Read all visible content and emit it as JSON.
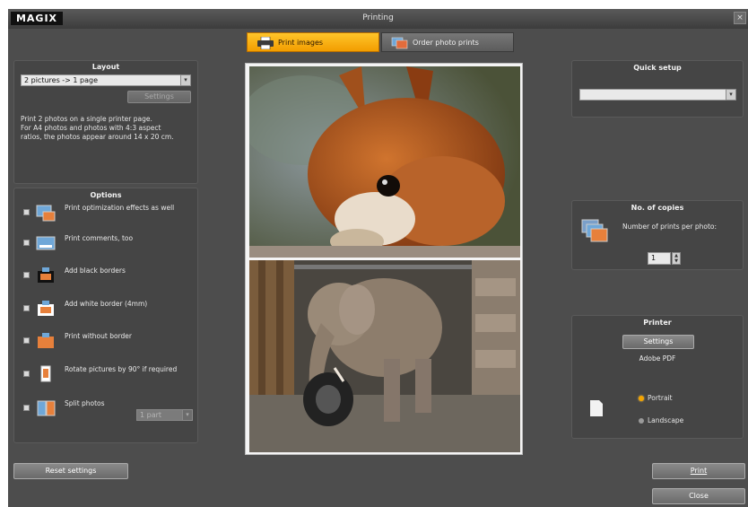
{
  "window": {
    "logo": "MAGIX",
    "title": "Printing",
    "close_glyph": "×"
  },
  "tabs": [
    {
      "label": "Print images",
      "icon": "printer-icon",
      "active": true
    },
    {
      "label": "Order photo prints",
      "icon": "photo-order-icon",
      "active": false
    }
  ],
  "layout": {
    "title": "Layout",
    "selected": "2 pictures -> 1 page",
    "settings_label": "Settings",
    "description": "Print 2 photos on a single printer page.\nFor A4 photos and photos with 4:3 aspect\nratios, the photos appear around 14 x 20 cm."
  },
  "options": {
    "title": "Options",
    "items": [
      {
        "label": "Print optimization effects as well",
        "icon": "effects-icon"
      },
      {
        "label": "Print comments, too",
        "icon": "comment-icon"
      },
      {
        "label": "Add black borders",
        "icon": "black-border-icon"
      },
      {
        "label": "Add white border (4mm)",
        "icon": "white-border-icon"
      },
      {
        "label": "Print without border",
        "icon": "no-border-icon"
      },
      {
        "label": "Rotate pictures by 90° if required",
        "icon": "rotate-icon"
      },
      {
        "label": "Split photos",
        "icon": "split-icon"
      }
    ],
    "split_value": "1 part"
  },
  "quick_setup": {
    "title": "Quick setup",
    "selected": ""
  },
  "copies": {
    "title": "No. of copies",
    "label": "Number of prints per photo:",
    "value": "1"
  },
  "printer": {
    "title": "Printer",
    "settings_label": "Settings",
    "name": "Adobe PDF",
    "orientation_options": [
      "Portrait",
      "Landscape"
    ],
    "selected_orientation": "Portrait"
  },
  "footer": {
    "reset_label": "Reset settings",
    "print_label": "Print",
    "close_label": "Close"
  },
  "colors": {
    "accent": "#f4a400",
    "window_bg": "#4d4d4d",
    "panel_bg": "#454545"
  }
}
